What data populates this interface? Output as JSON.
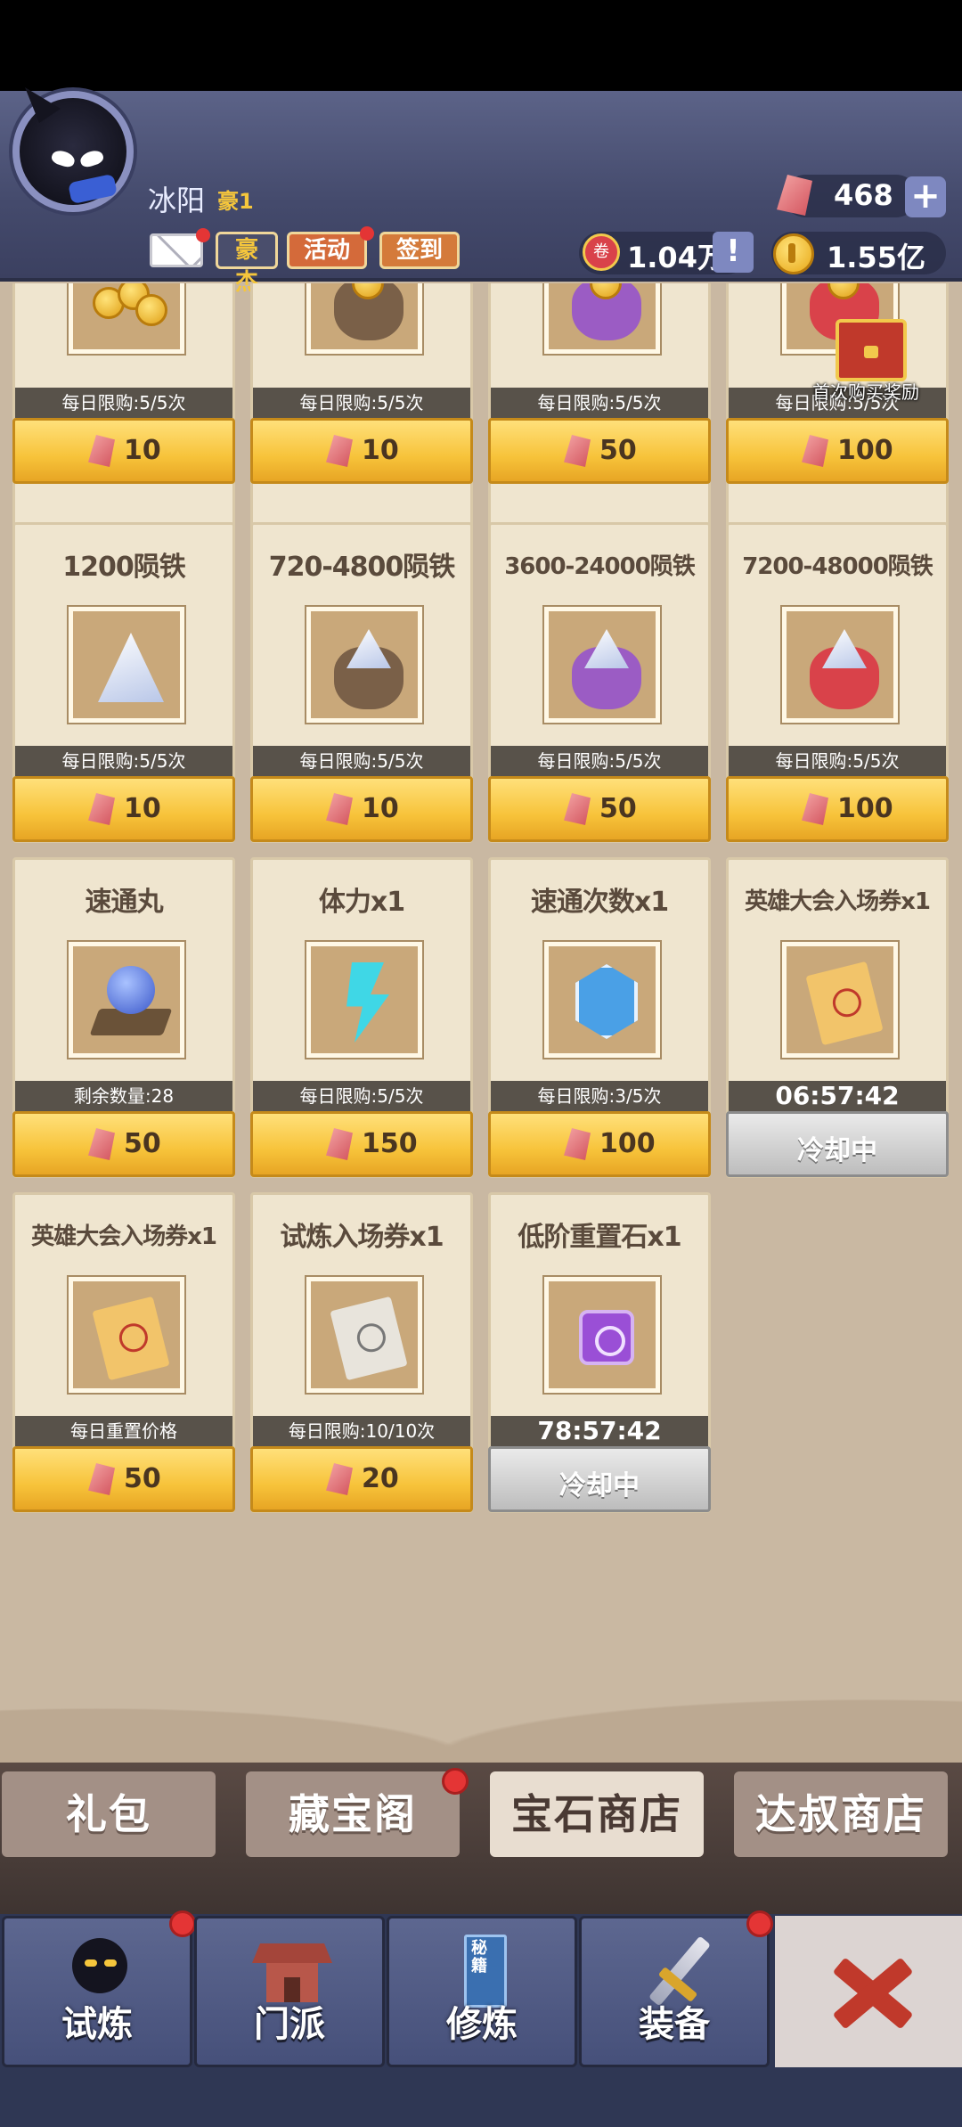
{
  "header": {
    "player_name": "冰阳",
    "vip": "豪1",
    "buttons": {
      "hero": "豪杰",
      "activity": "活动",
      "signin": "签到"
    },
    "gems": "468",
    "tickets": "1.04万",
    "ticket_symbol": "卷",
    "coins": "1.55亿",
    "plus": "+",
    "info": "!"
  },
  "grid": {
    "first_purchase_label": "首次购买奖励",
    "cooldown_label": "冷却中",
    "row0": [
      {
        "limit": "每日限购:5/5次",
        "price": "10"
      },
      {
        "limit": "每日限购:5/5次",
        "price": "10"
      },
      {
        "limit": "每日限购:5/5次",
        "price": "50"
      },
      {
        "limit": "每日限购:5/5次",
        "price": "100"
      }
    ],
    "row1": [
      {
        "title": "1200陨铁",
        "limit": "每日限购:5/5次",
        "price": "10"
      },
      {
        "title": "720-4800陨铁",
        "limit": "每日限购:5/5次",
        "price": "10"
      },
      {
        "title": "3600-24000陨铁",
        "limit": "每日限购:5/5次",
        "price": "50"
      },
      {
        "title": "7200-48000陨铁",
        "limit": "每日限购:5/5次",
        "price": "100"
      }
    ],
    "row2": [
      {
        "title": "速通丸",
        "limit": "剩余数量:28",
        "price": "50"
      },
      {
        "title": "体力x1",
        "limit": "每日限购:5/5次",
        "price": "150"
      },
      {
        "title": "速通次数x1",
        "limit": "每日限购:3/5次",
        "price": "100"
      },
      {
        "title": "英雄大会入场券x1",
        "timer": "06:57:42"
      }
    ],
    "row3": [
      {
        "title": "英雄大会入场券x1",
        "limit": "每日重置价格",
        "price": "50"
      },
      {
        "title": "试炼入场券x1",
        "limit": "每日限购:10/10次",
        "price": "20"
      },
      {
        "title": "低阶重置石x1",
        "timer": "78:57:42"
      }
    ]
  },
  "shop_tabs": [
    "礼包",
    "藏宝阁",
    "宝石商店",
    "达叔商店"
  ],
  "active_tab": "宝石商店",
  "bottom_nav": [
    "试炼",
    "门派",
    "修炼",
    "装备"
  ],
  "secret_book_label": "秘籍"
}
